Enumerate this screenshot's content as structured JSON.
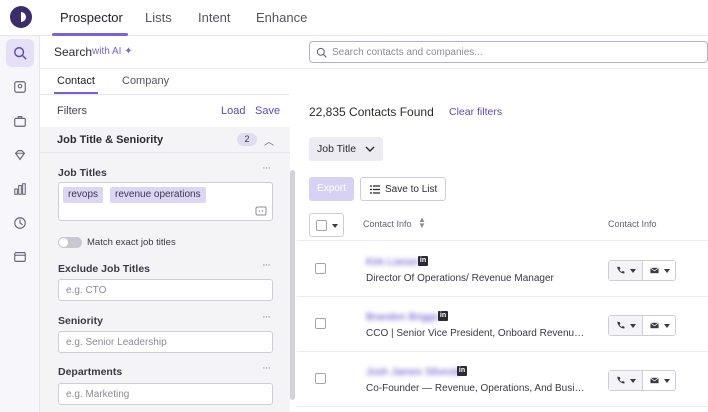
{
  "nav": {
    "tabs": [
      "Prospector",
      "Lists",
      "Intent",
      "Enhance"
    ],
    "active": "Prospector"
  },
  "rail": {
    "icons": [
      "search-icon",
      "contacts-icon",
      "companies-icon",
      "gem-icon",
      "chart-icon",
      "history-icon",
      "window-icon"
    ]
  },
  "search": {
    "label": "Search",
    "ai_label": "with AI",
    "placeholder": "Search contacts and companies..."
  },
  "subtabs": [
    "Contact",
    "Company"
  ],
  "filters": {
    "title": "Filters",
    "load": "Load",
    "save": "Save",
    "section_title": "Job Title & Seniority",
    "section_count": "2",
    "job_titles_label": "Job Titles",
    "job_titles": [
      "revops",
      "revenue operations"
    ],
    "match_exact": "Match exact job titles",
    "exclude_label": "Exclude Job Titles",
    "exclude_placeholder": "e.g. CTO",
    "seniority_label": "Seniority",
    "seniority_placeholder": "e.g. Senior Leadership",
    "departments_label": "Departments",
    "departments_placeholder": "e.g. Marketing"
  },
  "results": {
    "count_text": "22,835 Contacts Found",
    "clear": "Clear filters",
    "job_title_button": "Job Title",
    "export": "Export",
    "save_to_list": "Save to List",
    "col_contact": "Contact Info",
    "col_contact2": "Contact Info",
    "rows": [
      {
        "name": "Kirk Loeser",
        "title": "Director Of Operations/ Revenue Manager"
      },
      {
        "name": "Brandon Briggs",
        "title": "CCO | Senior Vice President, Onboard Revenue ..."
      },
      {
        "name": "Josh James Silvestri",
        "title": "Co-Founder — Revenue, Operations, And Busin..."
      }
    ]
  },
  "colors": {
    "accent": "#7b61d9",
    "link": "#5a4bbf",
    "tag": "#dcd6f4"
  }
}
